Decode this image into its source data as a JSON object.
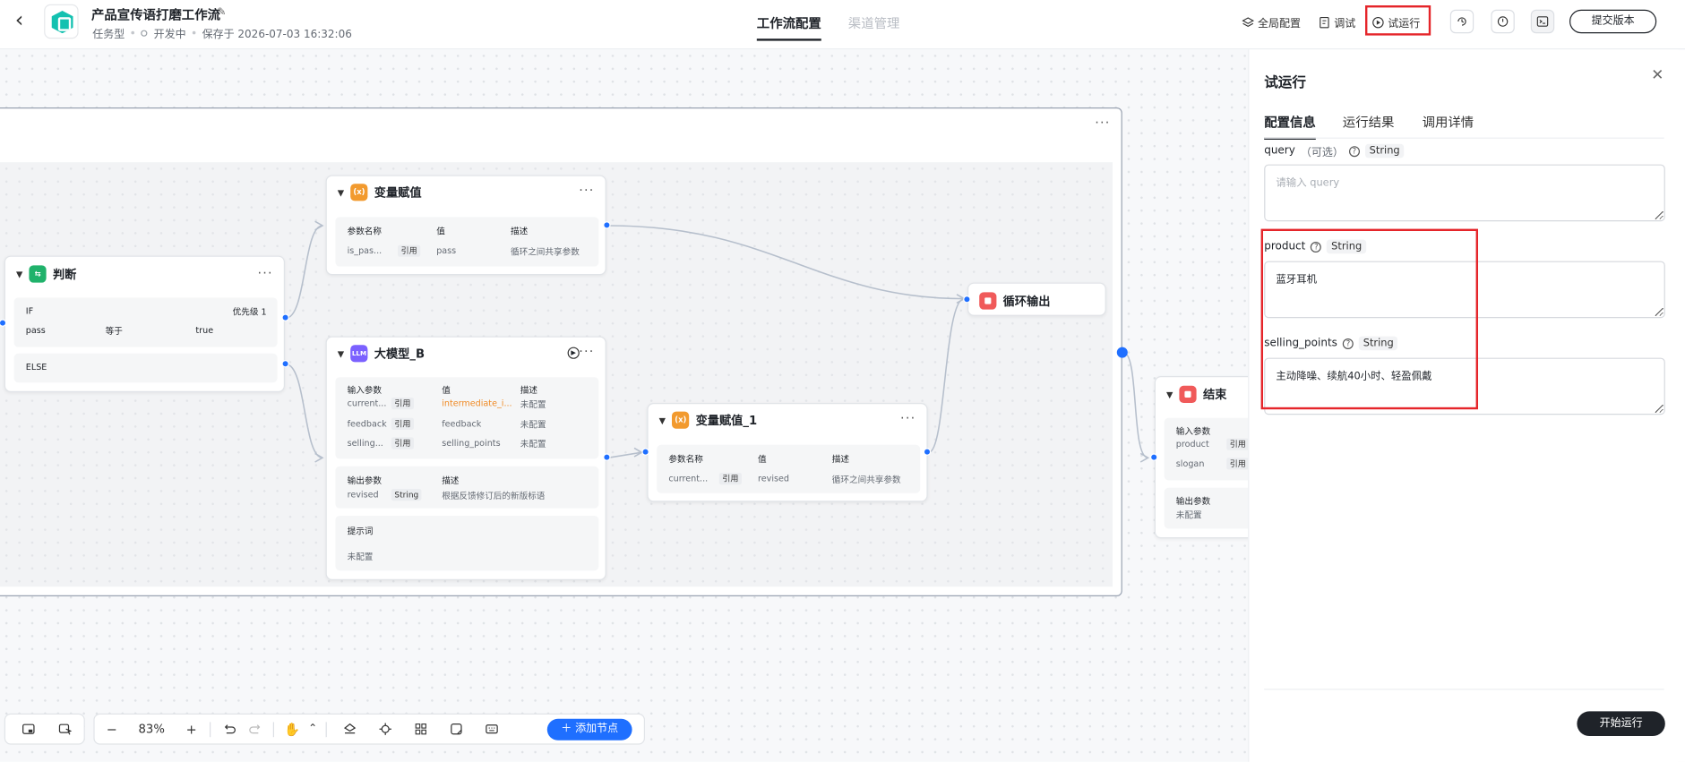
{
  "header": {
    "back": "‹",
    "title": "产品宣传语打磨工作流",
    "type": "任务型",
    "status": "开发中",
    "saved": "保存于 2026-07-03 16:32:06",
    "tabs": [
      "工作流配置",
      "渠道管理"
    ],
    "actions": {
      "global": "全局配置",
      "debug": "调试",
      "trial": "试运行",
      "submit": "提交版本"
    }
  },
  "nodes": {
    "judge": {
      "title": "判断",
      "if_label": "IF",
      "priority": "优先级 1",
      "cond_var": "pass",
      "cond_op": "等于",
      "cond_val": "true",
      "else_label": "ELSE"
    },
    "assign": {
      "title": "变量赋值",
      "h_name": "参数名称",
      "h_val": "值",
      "h_desc": "描述",
      "r_name": "is_pas...",
      "r_tag": "引用",
      "r_val": "pass",
      "r_desc": "循环之间共享参数"
    },
    "llm": {
      "icon": "LLM",
      "title": "大模型_B",
      "in_title": "输入参数",
      "h_val": "值",
      "h_desc": "描述",
      "rows": [
        {
          "name": "current...",
          "tag": "引用",
          "val": "intermediate_i...",
          "desc": "未配置"
        },
        {
          "name": "feedback",
          "tag": "引用",
          "val": "feedback",
          "desc": "未配置"
        },
        {
          "name": "selling...",
          "tag": "引用",
          "val": "selling_points",
          "desc": "未配置"
        }
      ],
      "out_title": "输出参数",
      "out_desc_h": "描述",
      "out_name": "revised",
      "out_type": "String",
      "out_desc": "根据反馈修订后的新版标语",
      "prompt_title": "提示词",
      "prompt_val": "未配置"
    },
    "assign1": {
      "title": "变量赋值_1",
      "h_name": "参数名称",
      "h_val": "值",
      "h_desc": "描述",
      "r_name": "current...",
      "r_tag": "引用",
      "r_val": "revised",
      "r_desc": "循环之间共享参数"
    },
    "loopout": {
      "title": "循环输出"
    },
    "end": {
      "title": "结束",
      "in_title": "输入参数",
      "rows": [
        {
          "name": "product",
          "tag": "引用"
        },
        {
          "name": "slogan",
          "tag": "引用"
        }
      ],
      "out_title": "输出参数",
      "out_val": "未配置"
    }
  },
  "toolbar": {
    "zoom": "83%",
    "add_node": "添加节点"
  },
  "panel": {
    "title": "试运行",
    "tabs": [
      "配置信息",
      "运行结果",
      "调用详情"
    ],
    "fields": [
      {
        "name": "query",
        "optional": "（可选）",
        "type": "String",
        "value": "",
        "placeholder": "请输入 query"
      },
      {
        "name": "product",
        "optional": "",
        "type": "String",
        "value": "蓝牙耳机",
        "placeholder": ""
      },
      {
        "name": "selling_points",
        "optional": "",
        "type": "String",
        "value": "主动降噪、续航40小时、轻盈佩戴",
        "placeholder": ""
      }
    ],
    "run": "开始运行"
  }
}
